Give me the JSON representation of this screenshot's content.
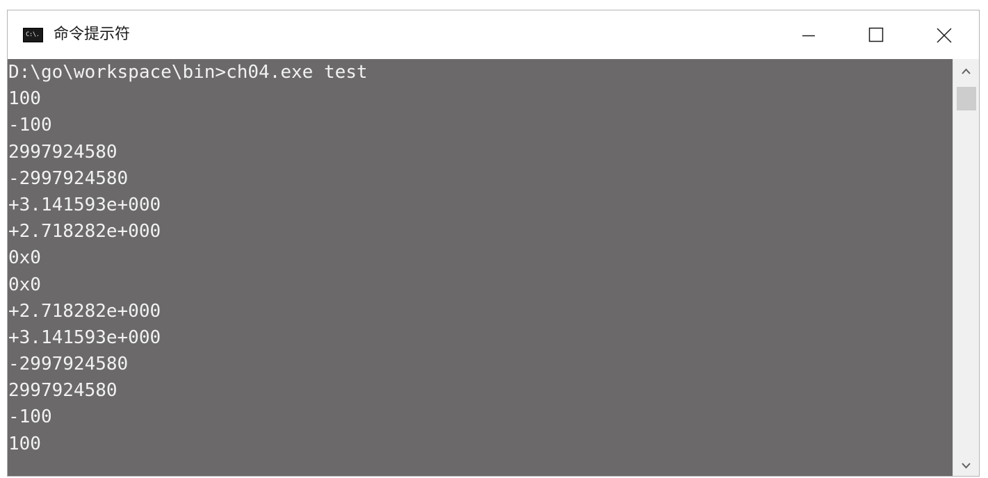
{
  "window": {
    "title": "命令提示符",
    "icon": "cmd-icon",
    "icon_text": "C:\\."
  },
  "controls": {
    "minimize_icon": "minimize-icon",
    "maximize_icon": "maximize-icon",
    "close_icon": "close-icon"
  },
  "console": {
    "background": "#6b696a",
    "foreground": "#f2f2f2",
    "lines": [
      "D:\\go\\workspace\\bin>ch04.exe test",
      "100",
      "-100",
      "2997924580",
      "-2997924580",
      "+3.141593e+000",
      "+2.718282e+000",
      "0x0",
      "0x0",
      "+2.718282e+000",
      "+3.141593e+000",
      "-2997924580",
      "2997924580",
      "-100",
      "100"
    ]
  },
  "scrollbar": {
    "up_icon": "chevron-up-icon",
    "down_icon": "chevron-down-icon"
  }
}
